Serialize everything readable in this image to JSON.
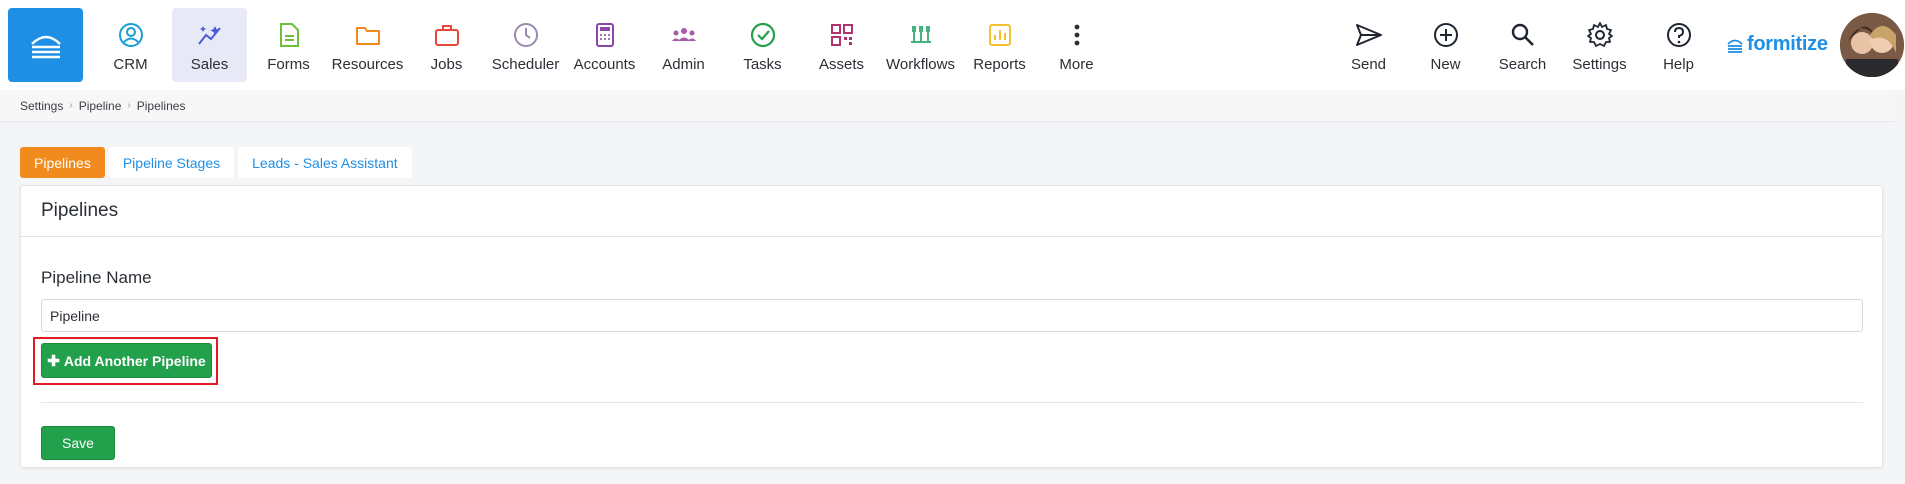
{
  "nav": {
    "items": [
      {
        "label": "CRM",
        "icon": "crm-icon",
        "color": "#1a9fd4"
      },
      {
        "label": "Sales",
        "icon": "sales-icon",
        "color": "#4a5bd6",
        "active": true
      },
      {
        "label": "Forms",
        "icon": "forms-icon",
        "color": "#6cbf3a"
      },
      {
        "label": "Resources",
        "icon": "resources-icon",
        "color": "#f28b1e"
      },
      {
        "label": "Jobs",
        "icon": "jobs-icon",
        "color": "#e8483b"
      },
      {
        "label": "Scheduler",
        "icon": "scheduler-icon",
        "color": "#9a8ab0"
      },
      {
        "label": "Accounts",
        "icon": "accounts-icon",
        "color": "#8a46a8"
      },
      {
        "label": "Admin",
        "icon": "admin-icon",
        "color": "#a65aa8"
      },
      {
        "label": "Tasks",
        "icon": "tasks-icon",
        "color": "#23a04b"
      },
      {
        "label": "Assets",
        "icon": "assets-icon",
        "color": "#b0336f"
      },
      {
        "label": "Workflows",
        "icon": "workflows-icon",
        "color": "#46b37e"
      },
      {
        "label": "Reports",
        "icon": "reports-icon",
        "color": "#f2c230"
      },
      {
        "label": "More",
        "icon": "more-icon",
        "color": "#2b2f36"
      }
    ],
    "right_items": [
      {
        "label": "Send",
        "icon": "send-icon"
      },
      {
        "label": "New",
        "icon": "new-icon"
      },
      {
        "label": "Search",
        "icon": "search-icon"
      },
      {
        "label": "Settings",
        "icon": "settings-icon"
      },
      {
        "label": "Help",
        "icon": "help-icon"
      }
    ],
    "brand": "formitize",
    "brand_color": "#1f8fe6"
  },
  "breadcrumb": [
    "Settings",
    "Pipeline",
    "Pipelines"
  ],
  "tabs": [
    {
      "label": "Pipelines",
      "active": true
    },
    {
      "label": "Pipeline Stages",
      "active": false
    },
    {
      "label": "Leads - Sales Assistant",
      "active": false
    }
  ],
  "panel": {
    "title": "Pipelines",
    "field_label": "Pipeline Name",
    "field_value": "Pipeline",
    "add_button": "Add Another Pipeline",
    "save_button": "Save"
  },
  "colors": {
    "primary": "#1f8fe6",
    "accent": "#f28b1e",
    "success": "#23a04b",
    "highlight": "#e31b23"
  }
}
